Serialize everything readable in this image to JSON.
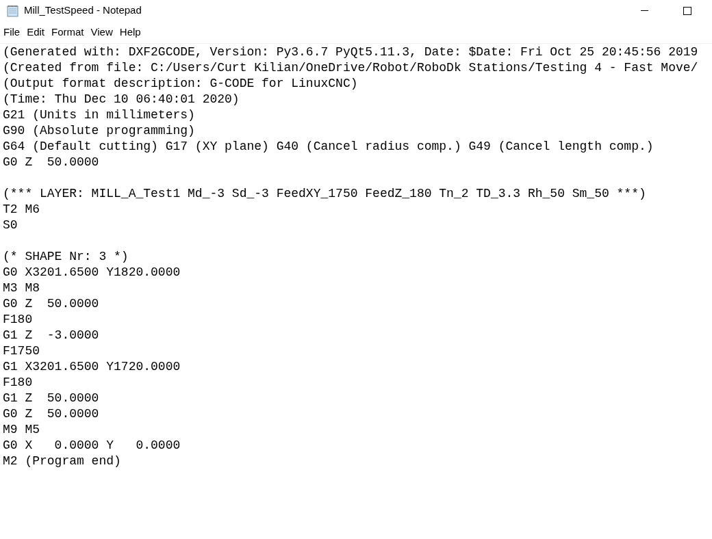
{
  "window": {
    "title": "Mill_TestSpeed - Notepad"
  },
  "menu": [
    "File",
    "Edit",
    "Format",
    "View",
    "Help"
  ],
  "text_blocks": [
    [
      "(Generated with: DXF2GCODE, Version: Py3.6.7 PyQt5.11.3, Date: $Date: Fri Oct 25 20:45:56 2019",
      "(Created from file: C:/Users/Curt Kilian/OneDrive/Robot/RoboDk Stations/Testing 4 - Fast Move/",
      "(Output format description: G-CODE for LinuxCNC)",
      "(Time: Thu Dec 10 06:40:01 2020)",
      "G21 (Units in millimeters)",
      "G90 (Absolute programming)",
      "G64 (Default cutting) G17 (XY plane) G40 (Cancel radius comp.) G49 (Cancel length comp.)",
      "G0 Z  50.0000"
    ],
    [
      "(*** LAYER: MILL_A_Test1 Md_-3 Sd_-3 FeedXY_1750 FeedZ_180 Tn_2 TD_3.3 Rh_50 Sm_50 ***)",
      "T2 M6",
      "S0"
    ],
    [
      "(* SHAPE Nr: 3 *)",
      "G0 X3201.6500 Y1820.0000",
      "M3 M8",
      "G0 Z  50.0000",
      "F180",
      "G1 Z  -3.0000",
      "F1750",
      "G1 X3201.6500 Y1720.0000",
      "F180",
      "G1 Z  50.0000",
      "G0 Z  50.0000",
      "M9 M5",
      "G0 X   0.0000 Y   0.0000",
      "M2 (Program end)"
    ]
  ]
}
